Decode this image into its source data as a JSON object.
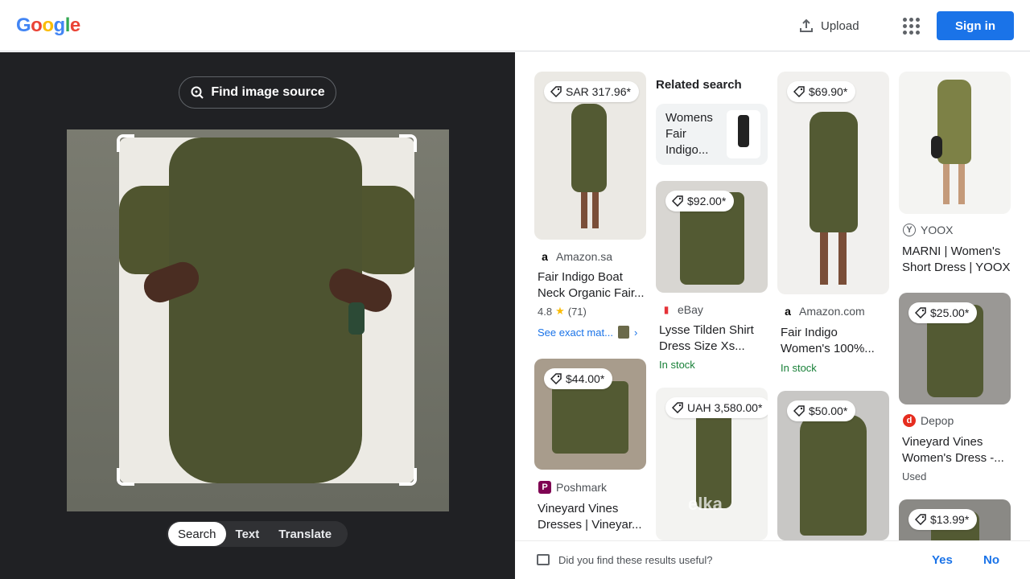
{
  "header": {
    "logo_letters": [
      {
        "ch": "G",
        "color": "#4285f4"
      },
      {
        "ch": "o",
        "color": "#ea4335"
      },
      {
        "ch": "o",
        "color": "#fbbc05"
      },
      {
        "ch": "g",
        "color": "#4285f4"
      },
      {
        "ch": "l",
        "color": "#34a853"
      },
      {
        "ch": "e",
        "color": "#ea4335"
      }
    ],
    "upload_label": "Upload",
    "signin_label": "Sign in",
    "apps_icon": "apps-grid-icon"
  },
  "left": {
    "find_source_label": "Find image source",
    "tabs": [
      {
        "label": "Search",
        "active": true
      },
      {
        "label": "Text",
        "active": false
      },
      {
        "label": "Translate",
        "active": false
      }
    ]
  },
  "results": {
    "related_heading": "Related search",
    "related_query": "Womens Fair Indigo...",
    "cards": [
      {
        "price": "SAR 317.96*",
        "source": "Amazon.sa",
        "title": "Fair Indigo Boat Neck Organic Fair...",
        "rating": "4.8",
        "reviews": "(71)",
        "exact": "See exact mat..."
      },
      {
        "price": "$44.00*",
        "source": "Poshmark",
        "title": "Vineyard Vines Dresses | Vineyar..."
      },
      {
        "price": "$92.00*",
        "source": "eBay",
        "title": "Lysse Tilden Shirt Dress Size Xs...",
        "status": "In stock"
      },
      {
        "price": "UAH 3,580.00*",
        "watermark": "elka"
      },
      {
        "price": "$69.90*",
        "source": "Amazon.com",
        "title": "Fair Indigo Women's 100%...",
        "status": "In stock"
      },
      {
        "price": "$50.00*"
      },
      {
        "source": "YOOX",
        "title": "MARNI | Women's Short Dress | YOOX"
      },
      {
        "price": "$25.00*",
        "source": "Depop",
        "title": "Vineyard Vines Women's Dress -...",
        "status": "Used"
      },
      {
        "price": "$13.99*"
      }
    ]
  },
  "footer": {
    "question": "Did you find these results useful?",
    "yes": "Yes",
    "no": "No"
  },
  "colors": {
    "accent": "#1a73e8",
    "dark_panel": "#202124",
    "in_stock": "#188038",
    "star": "#fbbc04"
  }
}
